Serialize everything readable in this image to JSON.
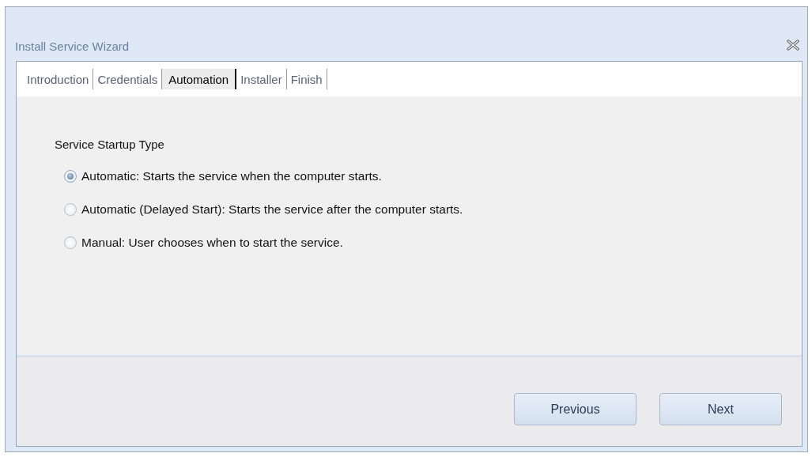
{
  "window": {
    "title": "Install Service Wizard"
  },
  "tabs": [
    {
      "label": "Introduction",
      "selected": false
    },
    {
      "label": "Credentials",
      "selected": false
    },
    {
      "label": "Automation",
      "selected": true
    },
    {
      "label": "Installer",
      "selected": false
    },
    {
      "label": "Finish",
      "selected": false
    }
  ],
  "section_title": "Service Startup Type",
  "options": [
    {
      "label": "Automatic:  Starts the service when the computer starts.",
      "selected": true
    },
    {
      "label": "Automatic (Delayed Start): Starts the service after the computer starts.",
      "selected": false
    },
    {
      "label": "Manual: User chooses when to start the service.",
      "selected": false
    }
  ],
  "buttons": [
    "Previous",
    "Next"
  ]
}
